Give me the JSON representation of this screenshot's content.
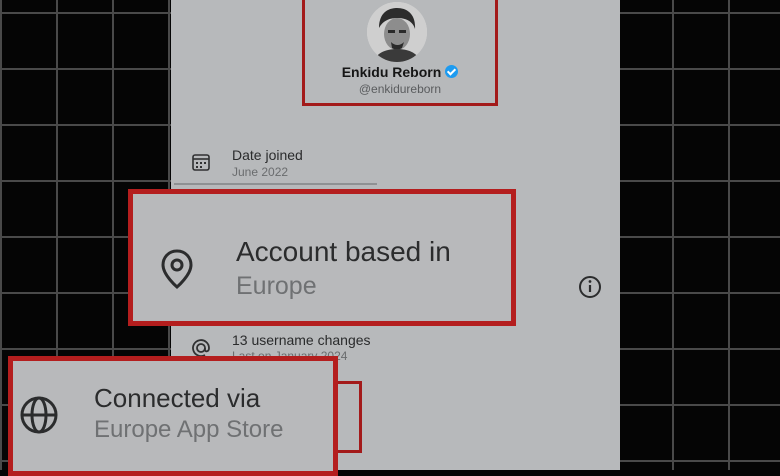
{
  "profile": {
    "name": "Enkidu Reborn",
    "handle": "@enkidureborn",
    "verified": true
  },
  "date_joined": {
    "label": "Date joined",
    "value": "June 2022",
    "icon": "calendar-icon"
  },
  "account_based": {
    "label": "Account based in",
    "value": "Europe",
    "icon": "location-pin-icon",
    "info_icon": "info-icon"
  },
  "username_changes": {
    "label": "13 username changes",
    "value": "Last on January 2024",
    "icon": "at-sign-icon"
  },
  "connected_via": {
    "label": "Connected via",
    "value": "Europe App Store",
    "icon": "globe-icon"
  },
  "colors": {
    "panel_bg": "#b7b9bb",
    "highlight_border": "#b41e1e",
    "verified": "#1d9bf0",
    "background": "#050505"
  }
}
